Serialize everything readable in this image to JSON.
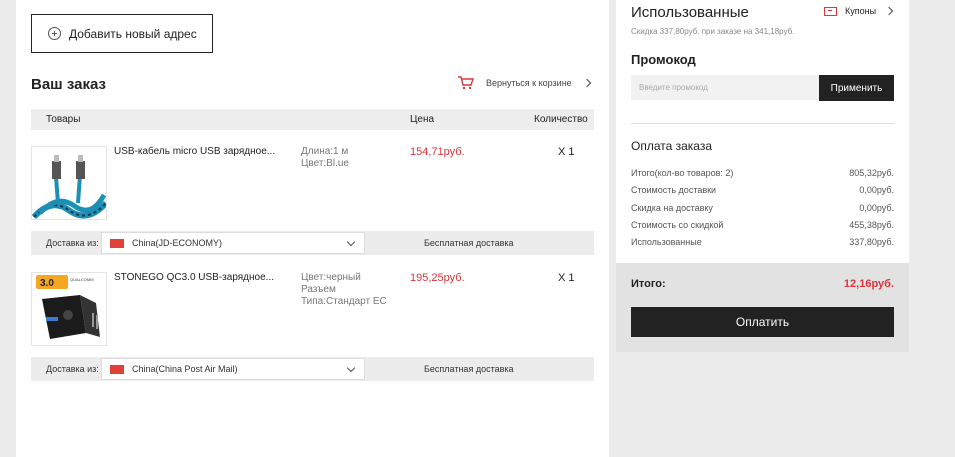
{
  "address": {
    "add_label": "Добавить новый адрес"
  },
  "order": {
    "title": "Ваш заказ",
    "back_to_cart": "Вернуться к корзине",
    "columns": {
      "goods": "Товары",
      "price": "Цена",
      "quantity": "Количество"
    },
    "items": [
      {
        "name": "USB-кабель micro USB зарядное...",
        "attrs": [
          "Длина:1 м",
          "Цвет:Bl.ue"
        ],
        "price": "154,71руб.",
        "qty": "X 1",
        "ship_label": "Доставка из:",
        "ship_method": "China(JD-ECONOMY)",
        "ship_cost": "Бесплатная доставка"
      },
      {
        "name": "STONEGO QC3.0 USB-зарядное...",
        "attrs": [
          "Цвет:черный",
          "Разъем",
          "Типа:Стандарт ЕС"
        ],
        "price": "195,25руб.",
        "qty": "X 1",
        "ship_label": "Доставка из:",
        "ship_method": "China(China Post Air Mail)",
        "ship_cost": "Бесплатная доставка",
        "thumb_badge": "3.0",
        "thumb_badge_sub": "QUALCOMM"
      }
    ]
  },
  "used": {
    "title": "Использованные",
    "coupons_label": "Купоны",
    "subtitle": "Скидка 337,80руб. при заказе на 341,18руб."
  },
  "promo": {
    "title": "Промокод",
    "placeholder": "Введите промокод",
    "apply_label": "Применить"
  },
  "payment": {
    "title": "Оплата заказа",
    "rows": [
      {
        "label": "Итого(кол-во товаров: 2)",
        "value": "805,32руб."
      },
      {
        "label": "Стоимость доставки",
        "value": "0,00руб."
      },
      {
        "label": "Скидка на доставку",
        "value": "0,00руб."
      },
      {
        "label": "Стоимость со скидкой",
        "value": "455,38руб."
      },
      {
        "label": "Использованные",
        "value": "337,80руб."
      }
    ],
    "total_label": "Итого:",
    "total_value": "12,16руб.",
    "pay_label": "Оплатить"
  },
  "colors": {
    "accent_red": "#d9363e",
    "dark": "#222222"
  }
}
